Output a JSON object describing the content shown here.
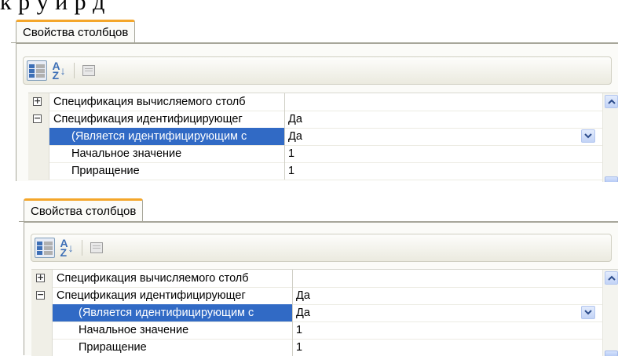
{
  "caption_fragment": "к  р  у           и           р  д",
  "panels": [
    {
      "tab_label": "Свойства столбцов",
      "toolbar": {
        "categorized_icon": "categorized-icon",
        "alphabetical_icon": "sort-az-icon",
        "property_pages_icon": "property-pages-icon"
      },
      "rows": [
        {
          "expander": "+",
          "name": "Спецификация вычисляемого столб",
          "value": ""
        },
        {
          "expander": "−",
          "name": "Спецификация идентифицирующег",
          "value": "Да"
        },
        {
          "expander": "",
          "name": "(Является идентифицирующим с",
          "value": "Да",
          "selected": true
        },
        {
          "expander": "",
          "name": "Начальное значение",
          "value": "1"
        },
        {
          "expander": "",
          "name": "Приращение",
          "value": "1"
        }
      ]
    },
    {
      "tab_label": "Свойства столбцов",
      "toolbar": {
        "categorized_icon": "categorized-icon",
        "alphabetical_icon": "sort-az-icon",
        "property_pages_icon": "property-pages-icon"
      },
      "rows": [
        {
          "expander": "+",
          "name": "Спецификация вычисляемого столб",
          "value": ""
        },
        {
          "expander": "−",
          "name": "Спецификация идентифицирующег",
          "value": "Да"
        },
        {
          "expander": "",
          "name": "(Является идентифицирующим с",
          "value": "Да",
          "selected": true
        },
        {
          "expander": "",
          "name": "Начальное значение",
          "value": "1"
        },
        {
          "expander": "",
          "name": "Приращение",
          "value": "1"
        }
      ]
    }
  ],
  "colors": {
    "tab_accent": "#f4a62a",
    "selection": "#316ac5",
    "toolbar_icon": "#3d6fb6"
  }
}
